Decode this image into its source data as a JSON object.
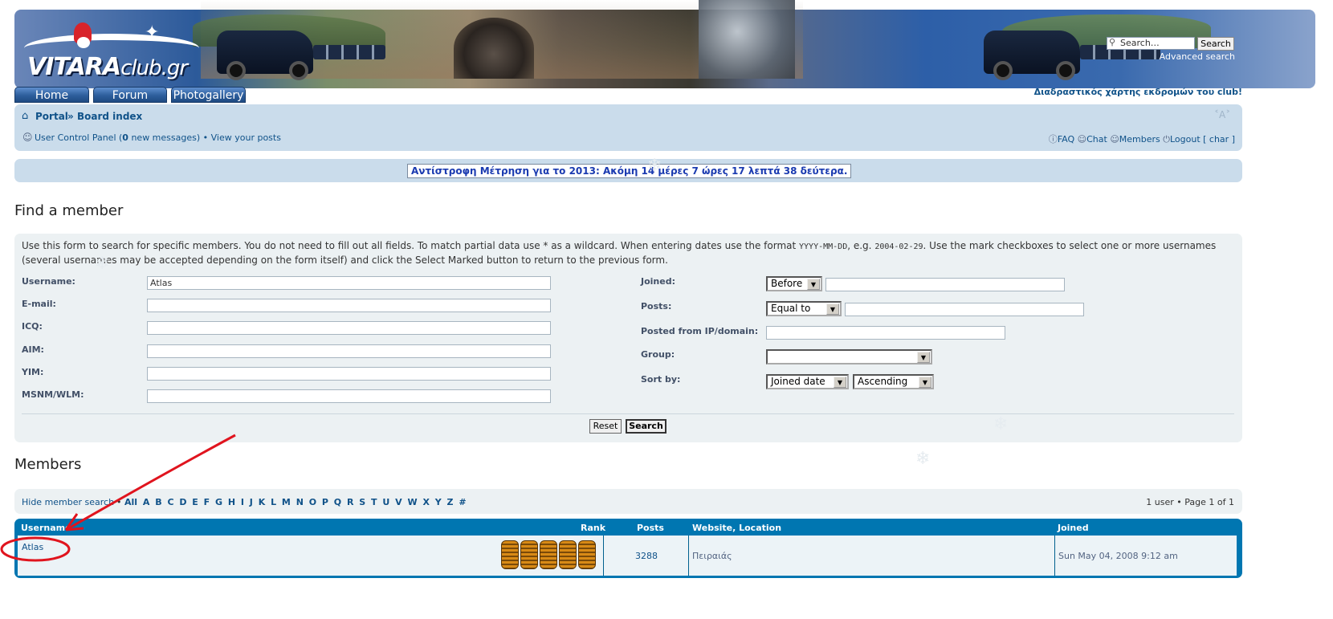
{
  "header": {
    "logo_main": "VITARA",
    "logo_suffix": "club.gr",
    "search_placeholder": "Search…",
    "search_button": "Search",
    "advanced_search": "Advanced search"
  },
  "nav": {
    "home": "Home",
    "forum": "Forum",
    "photogallery": "Photogallery",
    "map_link": "Διαδραστικός χάρτης εκδρομών του club!"
  },
  "breadcrumb": {
    "portal": "Portal",
    "separator": "»",
    "board_index": "Board index",
    "font_size_icon": "A"
  },
  "userbar": {
    "ucp_prefix": "User Control Panel (",
    "new_count": "0",
    "ucp_suffix": " new messages)",
    "bullet": "•",
    "view_posts": "View your posts",
    "faq": "FAQ",
    "chat": "Chat",
    "members": "Members",
    "logout": "Logout [ char ]"
  },
  "countdown": "Αντίστροφη Μέτρηση για το 2013: Ακόμη 14 μέρες 7 ώρες 17 λεπτά 38 δεύτερα.",
  "find": {
    "title": "Find a member",
    "desc_part1": "Use this form to search for specific members. You do not need to fill out all fields. To match partial data use * as a wildcard. When entering dates use the format ",
    "date_format": "YYYY-MM-DD",
    "desc_part2": ", e.g. ",
    "date_example": "2004-02-29",
    "desc_part3": ". Use the mark checkboxes to select one or more usernames (several usernames may be accepted depending on the form itself) and click the Select Marked button to return to the previous form.",
    "labels": {
      "username": "Username:",
      "email": "E-mail:",
      "icq": "ICQ:",
      "aim": "AIM:",
      "yim": "YIM:",
      "msnm": "MSNM/WLM:",
      "joined": "Joined:",
      "posts": "Posts:",
      "ip": "Posted from IP/domain:",
      "group": "Group:",
      "sort": "Sort by:"
    },
    "values": {
      "username": "Atlas",
      "joined_select": "Before",
      "posts_select": "Equal to",
      "group_select": "",
      "sort_key": "Joined date",
      "sort_dir": "Ascending"
    },
    "reset": "Reset",
    "search": "Search"
  },
  "members": {
    "title": "Members",
    "hide_search": "Hide member search",
    "bullet": "•",
    "letters": "All A B C D E F G H I J K L M N O P Q R S T U V W X Y Z #",
    "page_info": "1 user • Page 1 of 1",
    "columns": {
      "username": "Username",
      "rank": "Rank",
      "posts": "Posts",
      "website": "Website, Location",
      "joined": "Joined"
    },
    "rows": [
      {
        "username": "Atlas",
        "posts": "3288",
        "location": "Πειραιάς",
        "joined": "Sun May 04, 2008 9:12 am",
        "rank_icon": "tires-rank-icon"
      }
    ]
  },
  "colors": {
    "accent": "#105289",
    "table_header": "#0076b1",
    "panel": "#ecf1f3",
    "navbar": "#cadceb",
    "annotation": "#e0141e"
  }
}
